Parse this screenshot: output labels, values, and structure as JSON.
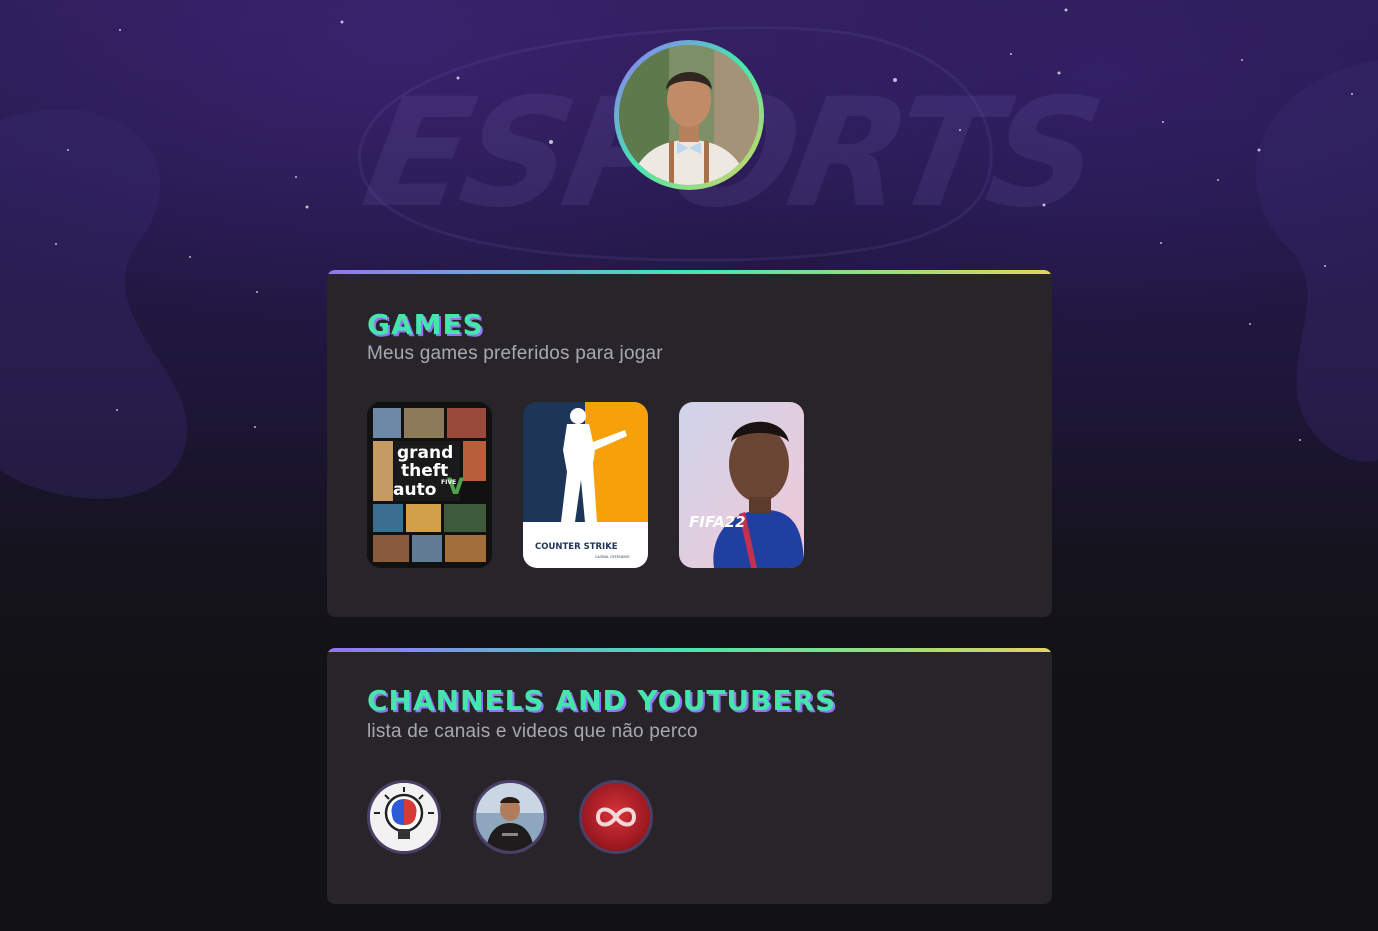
{
  "profile": {
    "avatar_alt": "Foto de perfil"
  },
  "background": {
    "watermark_text": "ESPORTS"
  },
  "games_section": {
    "title": "GAMES",
    "subtitle": "Meus games preferidos para jogar",
    "items": [
      {
        "name": "grand theft auto V",
        "label_line1": "grand",
        "label_line2": "theft",
        "label_line3": "auto",
        "badge": "FIVE"
      },
      {
        "name": "Counter Strike",
        "label": "COUNTER STRIKE",
        "sublabel": "GLOBAL OFFENSIVE"
      },
      {
        "name": "FIFA 22",
        "label": "FIFA22"
      }
    ]
  },
  "channels_section": {
    "title": "CHANNELS AND YOUTUBERS",
    "subtitle": "lista de canais e videos que não perco",
    "items": [
      {
        "name": "brain-channel"
      },
      {
        "name": "fitness-channel"
      },
      {
        "name": "infinity-channel"
      }
    ]
  },
  "colors": {
    "background": "#121214",
    "card": "#28252a",
    "accent_green": "#43e7ad",
    "accent_purple": "#9572fc",
    "accent_yellow": "#e2d45c",
    "subtitle": "#a8a8b3"
  }
}
